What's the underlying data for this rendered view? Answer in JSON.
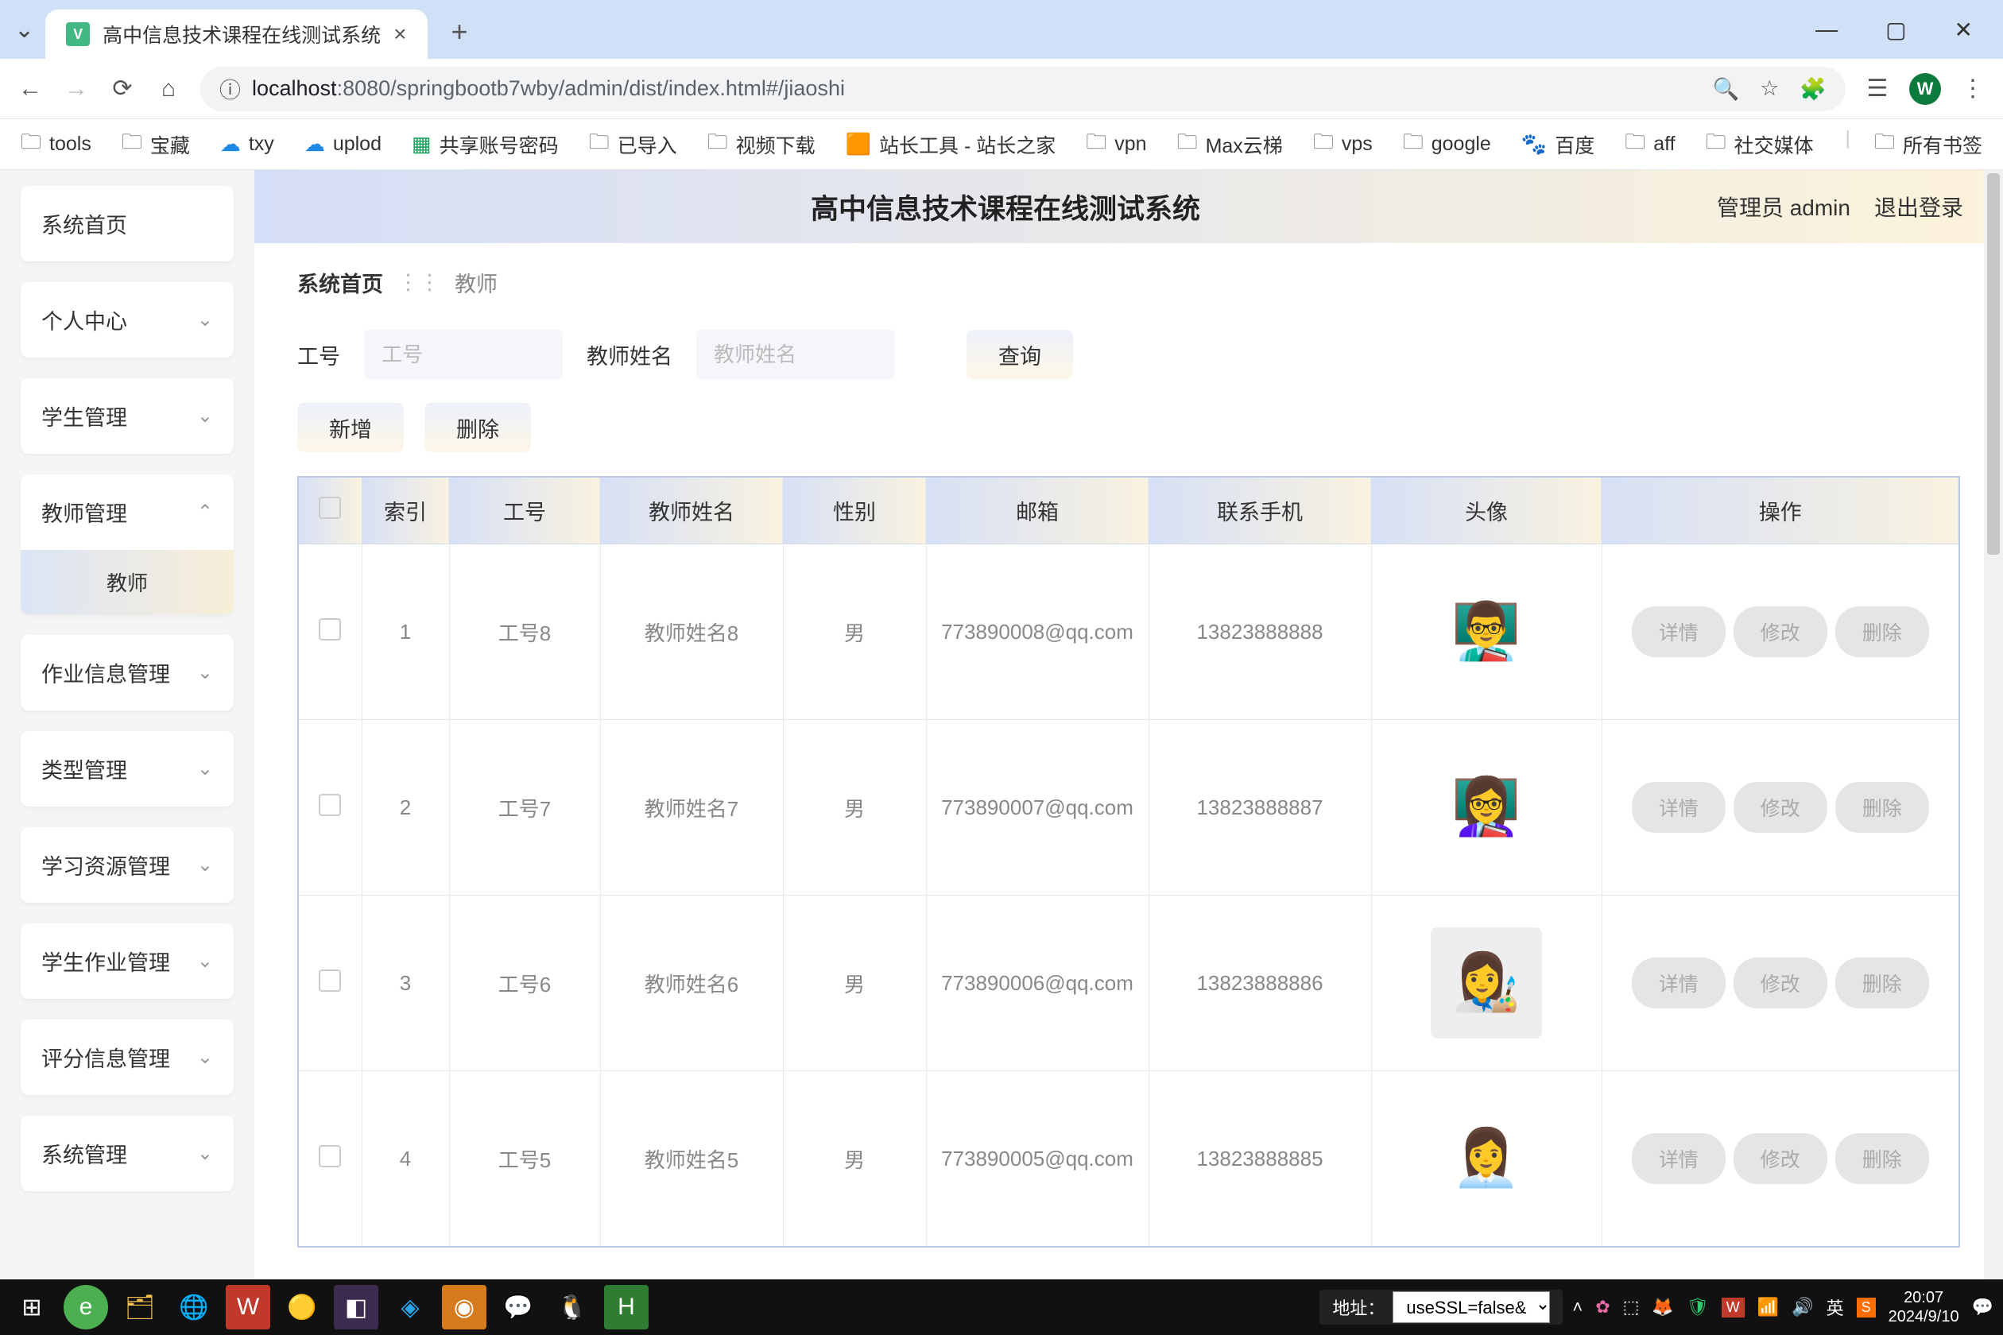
{
  "browser": {
    "tab_title": "高中信息技术课程在线测试系统",
    "url_protocol": "ⓘ",
    "url_host": "localhost",
    "url_port_path": ":8080/springbootb7wby/admin/dist/index.html#/jiaoshi",
    "new_tab": "+",
    "close": "×"
  },
  "bookmarks": {
    "items": [
      "tools",
      "宝藏",
      "txy",
      "uplod",
      "共享账号密码",
      "已导入",
      "视频下载",
      "站长工具 - 站长之家",
      "vpn",
      "Max云梯",
      "vps",
      "google",
      "百度",
      "aff",
      "社交媒体"
    ],
    "all": "所有书签"
  },
  "sidebar": {
    "home": "系统首页",
    "personal": "个人中心",
    "student_mgmt": "学生管理",
    "teacher_mgmt": "教师管理",
    "teacher_sub": "教师",
    "homework_mgmt": "作业信息管理",
    "type_mgmt": "类型管理",
    "resource_mgmt": "学习资源管理",
    "student_hw_mgmt": "学生作业管理",
    "score_mgmt": "评分信息管理",
    "system_mgmt": "系统管理"
  },
  "header": {
    "title": "高中信息技术课程在线测试系统",
    "user": "管理员 admin",
    "logout": "退出登录"
  },
  "breadcrumb": {
    "home": "系统首页",
    "current": "教师"
  },
  "search": {
    "id_label": "工号",
    "id_placeholder": "工号",
    "name_label": "教师姓名",
    "name_placeholder": "教师姓名",
    "query_btn": "查询",
    "add_btn": "新增",
    "delete_btn": "删除"
  },
  "table": {
    "headers": {
      "index": "索引",
      "id": "工号",
      "name": "教师姓名",
      "gender": "性别",
      "email": "邮箱",
      "phone": "联系手机",
      "avatar": "头像",
      "ops": "操作"
    },
    "rows": [
      {
        "idx": "1",
        "id": "工号8",
        "name": "教师姓名8",
        "gender": "男",
        "email": "773890008@qq.com",
        "phone": "13823888888",
        "avatar_emoji": "👨‍🏫",
        "avatar_bg": "#fff"
      },
      {
        "idx": "2",
        "id": "工号7",
        "name": "教师姓名7",
        "gender": "男",
        "email": "773890007@qq.com",
        "phone": "13823888887",
        "avatar_emoji": "👩‍🏫",
        "avatar_bg": "#fff"
      },
      {
        "idx": "3",
        "id": "工号6",
        "name": "教师姓名6",
        "gender": "男",
        "email": "773890006@qq.com",
        "phone": "13823888886",
        "avatar_emoji": "👩‍🎨",
        "avatar_bg": "#eee"
      },
      {
        "idx": "4",
        "id": "工号5",
        "name": "教师姓名5",
        "gender": "男",
        "email": "773890005@qq.com",
        "phone": "13823888885",
        "avatar_emoji": "👩‍💼",
        "avatar_bg": "#fff"
      }
    ],
    "ops": {
      "detail": "详情",
      "edit": "修改",
      "delete": "删除"
    }
  },
  "taskbar": {
    "addr_label": "地址：",
    "select_value": "useSSL=false&",
    "time": "20:07",
    "date": "2024/9/10",
    "ime": "英"
  }
}
